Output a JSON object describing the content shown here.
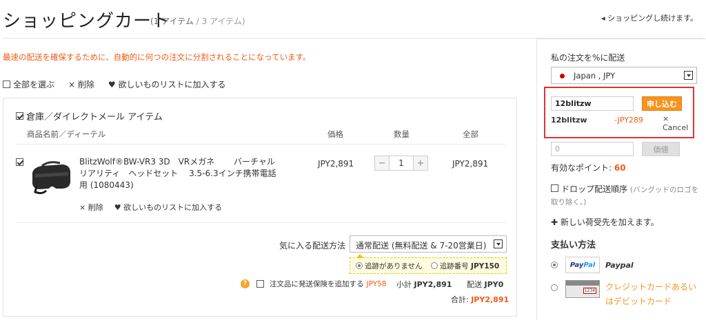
{
  "header": {
    "title": "ショッピングカート",
    "count_part1": "(1 アイテム",
    "count_part2": " / 3 アイテム)",
    "continue_label": "◂ ショッピングし続けます。"
  },
  "notice": "最速の配送を確保するために、自動的に何つの注文に分割されることになっています。",
  "actions": {
    "select_all": "全部を選ぶ",
    "delete": "× 削除",
    "wishlist": "♥ 欲しいものリストに加入する"
  },
  "cart": {
    "warehouse_label": "倉庫／ダイレクトメール アイテム",
    "columns": {
      "product": "商品名前／ディーテル",
      "price": "価格",
      "quantity": "数量",
      "total": "全部"
    },
    "item": {
      "name": "BlitzWolf®BW-VR3 3D　VRメガネ　　 バーチャルリアリティ　ヘッドセット　 3.5-6.3インチ携帯電話用 (1080443)",
      "price": "JPY2,891",
      "quantity": "1",
      "total": "JPY2,891",
      "delete": "× 削除",
      "wishlist": "♥ 欲しいものリストに加入する"
    },
    "shipping": {
      "label": "気に入る配送方法",
      "selected": "通常配送 (無料配送 & 7-20営業日)",
      "option_no_tracking": "追跡がありません",
      "option_tracking": "追跡番号",
      "option_tracking_price": "JPY150"
    },
    "insurance": {
      "label": "注文品に発送保険を追加する",
      "price": "JPY58"
    },
    "subtotal_label": "小計",
    "subtotal": "JPY2,891",
    "shipping_fee_label": "配送",
    "shipping_fee": "JPY0",
    "grand_total_label": "合計:",
    "grand_total": "JPY2,891"
  },
  "sidebar": {
    "ship_to_label": "私の注文を%に配送",
    "country": "Japan , JPY",
    "coupon": {
      "code_value": "12blitzw",
      "apply_label": "申し込む",
      "applied_code": "12blitzw",
      "discount": "-JPY289",
      "cancel_x": "×",
      "cancel_label": "Cancel"
    },
    "points": {
      "input_value": "0",
      "button_label": "価値",
      "available_label": "有効なポイント: ",
      "available_value": "60"
    },
    "drop_ship": {
      "label": "ドロップ配送順序",
      "hint": "(バングッドのロゴを取り除く。)"
    },
    "new_address": "✚ 新しい荷受先を加えます。",
    "payment": {
      "title": "支払い方法",
      "paypal": "Paypal",
      "credit_card": "クレジットカードあるいはデビットカード"
    }
  },
  "colors": {
    "accent_orange": "#f7931e",
    "warning_text": "#f05a14",
    "highlight_box": "#e53030"
  }
}
